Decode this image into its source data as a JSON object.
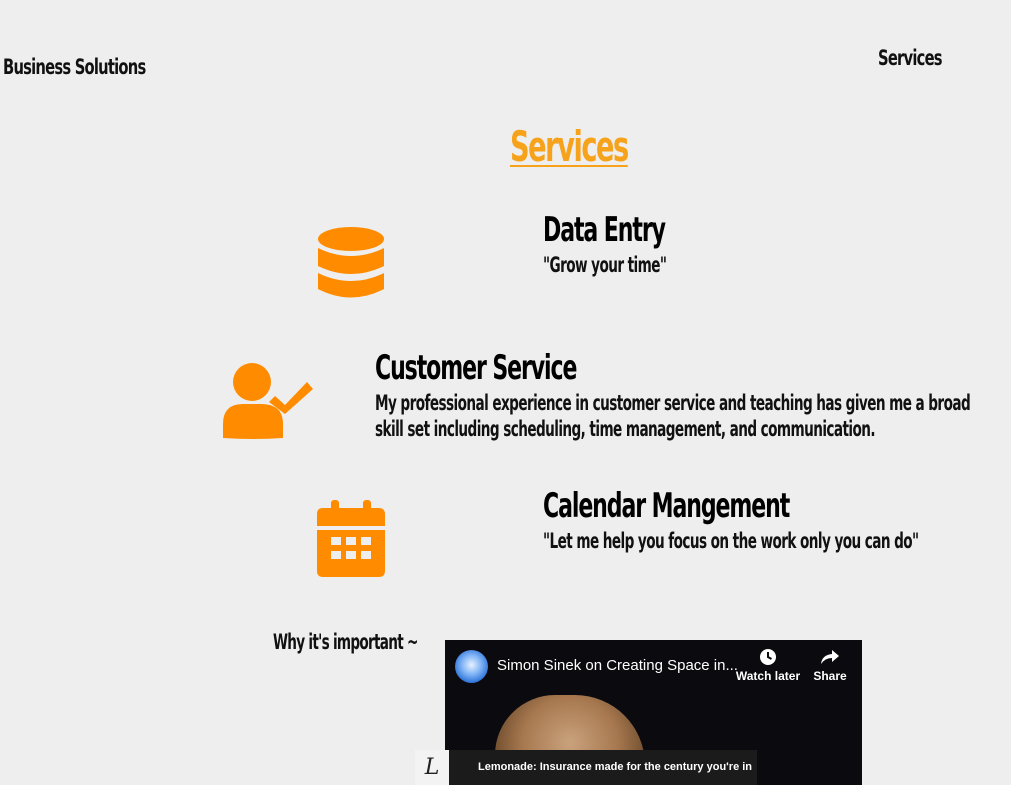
{
  "header": {
    "brand": "Business Solutions",
    "nav": [
      {
        "label": "Services"
      }
    ]
  },
  "section": {
    "title": "Services"
  },
  "services": [
    {
      "icon": "database-icon",
      "title": "Data Entry",
      "description": "\"Grow your time\""
    },
    {
      "icon": "user-check-icon",
      "title": "Customer Service",
      "description": "My professional experience in customer service and teaching has given me a broad skill set including scheduling, time management, and communication."
    },
    {
      "icon": "calendar-icon",
      "title": "Calendar Mangement",
      "description": "\"Let me help you focus on the work only you can do\""
    }
  ],
  "why": {
    "label": "Why it's important ~"
  },
  "video": {
    "title": "Simon Sinek on Creating Space in...",
    "watch_later": "Watch later",
    "share": "Share"
  },
  "ad": {
    "logo_text": "L",
    "text": "Lemonade: Insurance made for the century you're in"
  },
  "colors": {
    "accent": "#f7a21b",
    "icon": "#ff8c00",
    "background": "#eeeeee"
  }
}
